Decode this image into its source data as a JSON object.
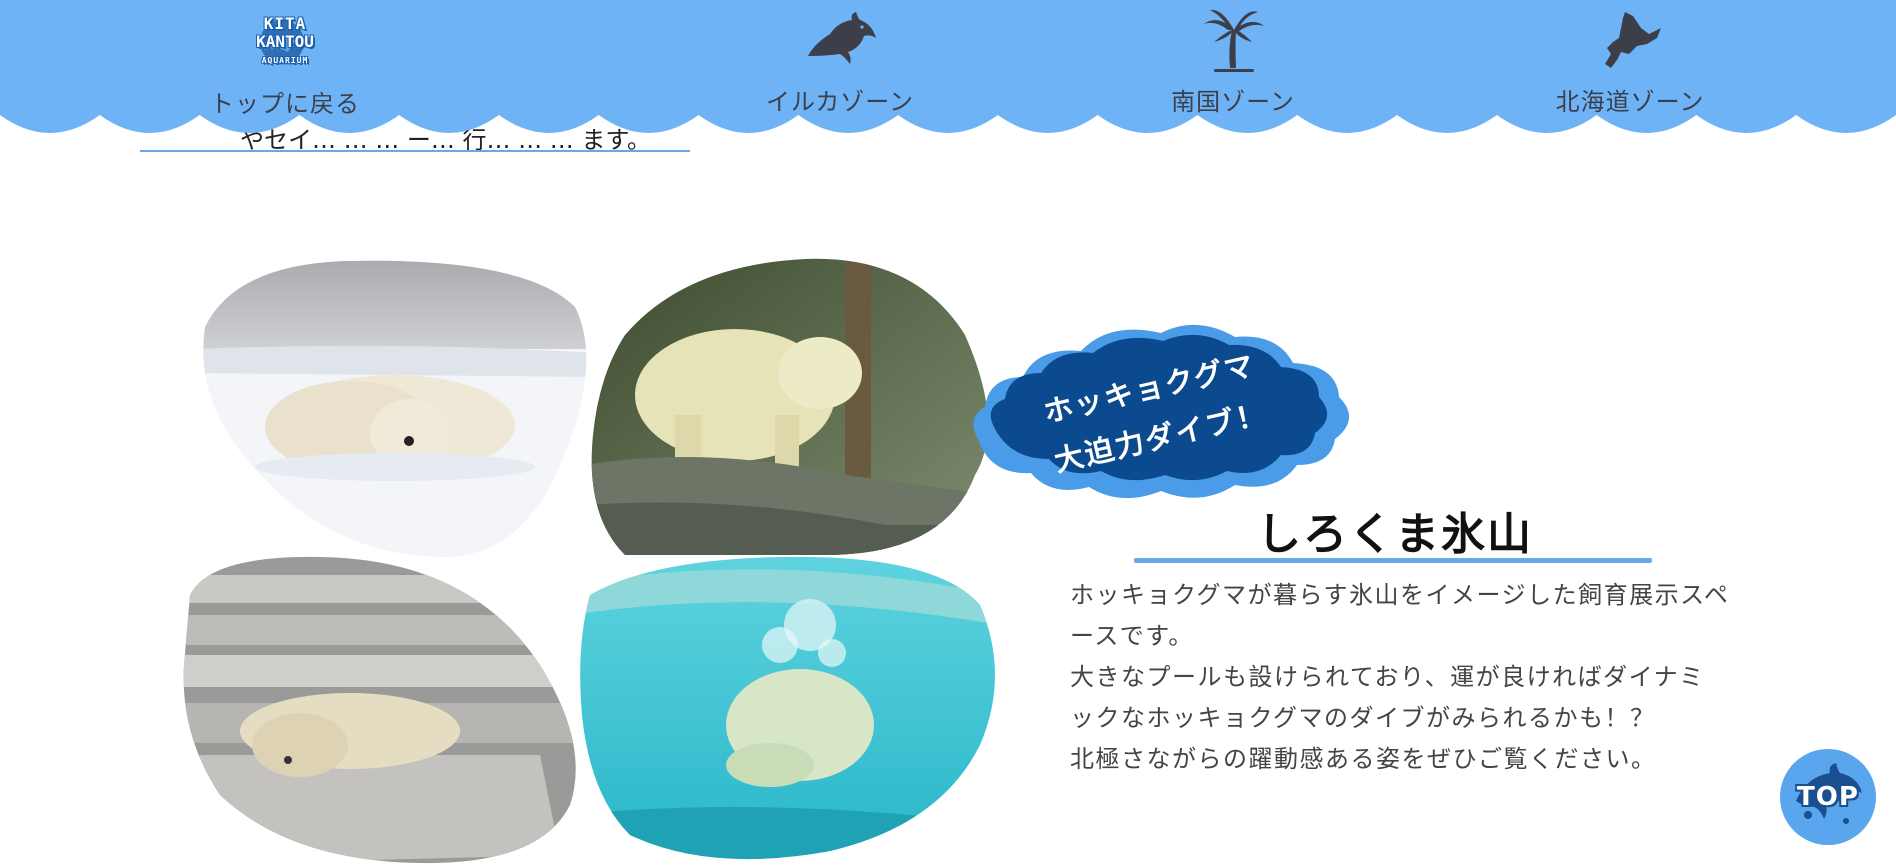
{
  "header": {
    "logo": {
      "line1": "KITA",
      "line2": "KANTOU",
      "line3": "AQUARIUM"
    },
    "nav": [
      {
        "label": "トップに戻る",
        "icon": "logo-icon"
      },
      {
        "label": "イルカゾーン",
        "icon": "dolphin-icon"
      },
      {
        "label": "南国ゾーン",
        "icon": "palm-tree-icon"
      },
      {
        "label": "北海道ゾーン",
        "icon": "hokkaido-map-icon"
      }
    ],
    "background_color": "#6fb3f7",
    "icon_color": "#3c3f4a"
  },
  "behind_text": "やセイ… … … ー… 行… … … ます。",
  "badge": {
    "line1": "ホッキョクグマ",
    "line2": "大迫力ダイブ！",
    "color_dark": "#0c4a8f",
    "color_light": "#4a9be8"
  },
  "section": {
    "title": "しろくま氷山",
    "paragraphs": [
      "ホッキョクグマが暮らす氷山をイメージした飼育展示スペースです。",
      "大きなプールも設けられており、運が良ければダイナミックなホッキョクグマのダイブがみられるかも！？",
      "北極さながらの躍動感ある姿をぜひご覧ください。"
    ],
    "underline_color": "#6aa8e8"
  },
  "photos": [
    {
      "name": "polar-bear-sleeping-snow-photo"
    },
    {
      "name": "polar-bear-standing-rock-photo"
    },
    {
      "name": "polar-bear-resting-stone-photo"
    },
    {
      "name": "polar-bear-diving-pool-photo"
    }
  ],
  "top_button": {
    "label": "TOP",
    "icon": "dolphin-icon"
  }
}
